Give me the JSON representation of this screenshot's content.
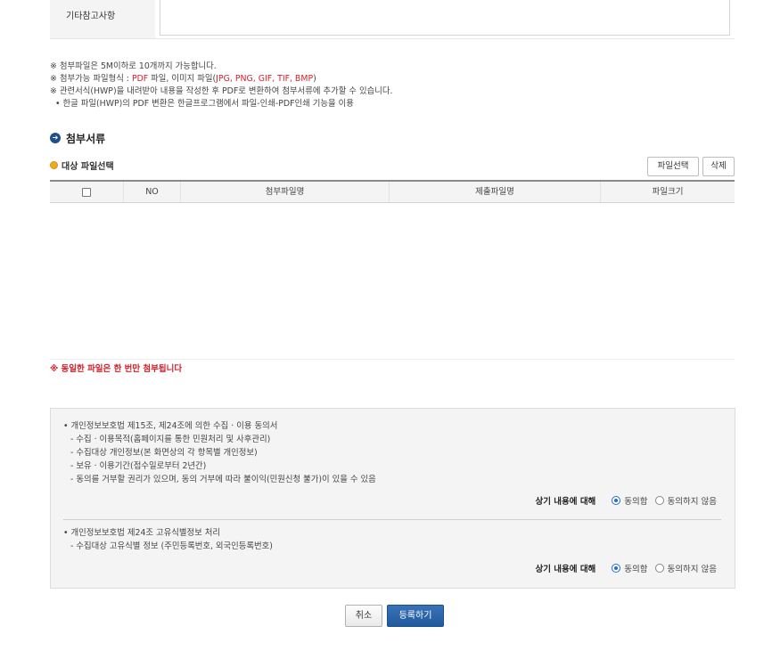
{
  "form": {
    "etc_label": "기타참고사항",
    "etc_value": ""
  },
  "notes": {
    "line1": "※ 첨부파일은 5M이하로 10개까지 가능합니다.",
    "line2_prefix": "※ 첨부가능 파일형식 : ",
    "line2_pdf": "PDF",
    "line2_mid": " 파일, 이미지 파일(",
    "line2_images": "JPG, PNG, GIF, TIF, BMP",
    "line2_suffix": ")",
    "line3": "※ 관련서식(HWP)을 내려받아 내용을 작성한 후 PDF로 변환하여 첨부서류에 추가할 수 있습니다.",
    "line4": "• 한글 파일(HWP)의 PDF 변환은 한글프로그램에서 파일-인쇄-PDF인쇄 기능을 이용"
  },
  "attach": {
    "section_title": "첨부서류",
    "section_icon": "➔",
    "sub_title": "대상 파일선택",
    "select_button": "파일선택",
    "delete_button": "삭제",
    "columns": [
      "NO",
      "첨부파일명",
      "제출파일명",
      "파일크기"
    ],
    "rows": [],
    "warning": "※ 동일한 파일은 한 번만 첨부됩니다"
  },
  "agreement": {
    "block1": [
      "• 개인정보보호법 제15조, 제24조에 의한 수집 · 이용 동의서",
      "  - 수집 · 이용목적(홈페이지를 통한 민원처리 및 사후관리)",
      "  - 수집대상 개인정보(본 화면상의 각 항목별 개인정보)",
      "  - 보유 · 이용기간(접수일로부터 2년간)",
      "  - 동의를 거부할 권리가 있으며, 동의  거부에 따라 불이익(민원신청 불가)이 있을 수 있음"
    ],
    "block2": [
      "• 개인정보보호법 제24조 고유식별정보 처리",
      "  - 수집대상 고유식별 정보 (주민등록번호, 외국인등록번호)"
    ],
    "question": "상기 내용에 대해",
    "agree_label": "동의함",
    "disagree_label": "동의하지 않음",
    "selected1": "agree",
    "selected2": "agree"
  },
  "actions": {
    "cancel": "취소",
    "submit": "등록하기"
  },
  "colors": {
    "accent": "#225a9e",
    "warning": "#d2232a",
    "bullet": "#f0a81c"
  }
}
